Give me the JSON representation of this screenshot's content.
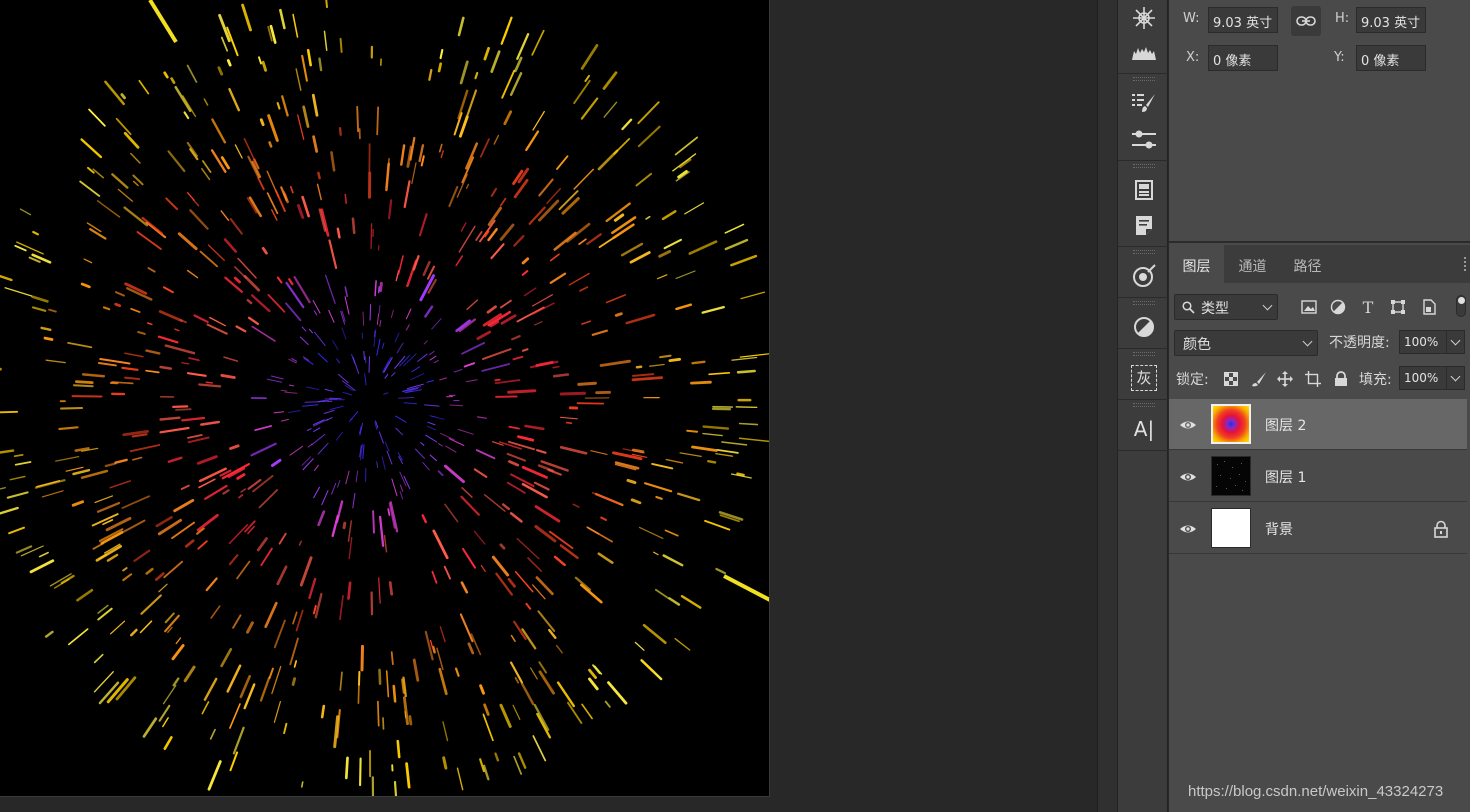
{
  "canvas": {
    "background": "#000000"
  },
  "properties": {
    "w_label": "W:",
    "w_value": "9.03 英寸",
    "h_label": "H:",
    "h_value": "9.03 英寸",
    "x_label": "X:",
    "x_value": "0 像素",
    "y_label": "Y:",
    "y_value": "0 像素",
    "link_icon": "link-icon"
  },
  "iconbar": {
    "icons": [
      "navigator-icon",
      "histogram-icon",
      "brush-presets-icon",
      "adjustments-icon",
      "libraries-icon",
      "notes-icon",
      "3d-icon",
      "adjustment-circle-icon",
      "grayscale-icon",
      "character-icon"
    ],
    "grayscale_glyph": "灰",
    "character_glyph": "A|"
  },
  "layers_panel": {
    "tabs": [
      {
        "label": "图层",
        "active": true
      },
      {
        "label": "通道",
        "active": false
      },
      {
        "label": "路径",
        "active": false
      }
    ],
    "filter_kind": "类型",
    "blend_mode": "颜色",
    "opacity_label": "不透明度:",
    "opacity_value": "100%",
    "lock_label": "锁定:",
    "fill_label": "填充:",
    "fill_value": "100%",
    "layers": [
      {
        "name": "图层 2",
        "selected": true,
        "thumb": "gradient",
        "visible": true
      },
      {
        "name": "图层 1",
        "selected": false,
        "thumb": "dark",
        "visible": true
      },
      {
        "name": "背景",
        "selected": false,
        "thumb": "white",
        "visible": true,
        "locked": true
      }
    ]
  },
  "watermark": "https://blog.csdn.net/weixin_43324273",
  "colors": {
    "accent_panel": "#4a4a4a",
    "selected_layer": "#676767",
    "workspace": "#282828"
  }
}
